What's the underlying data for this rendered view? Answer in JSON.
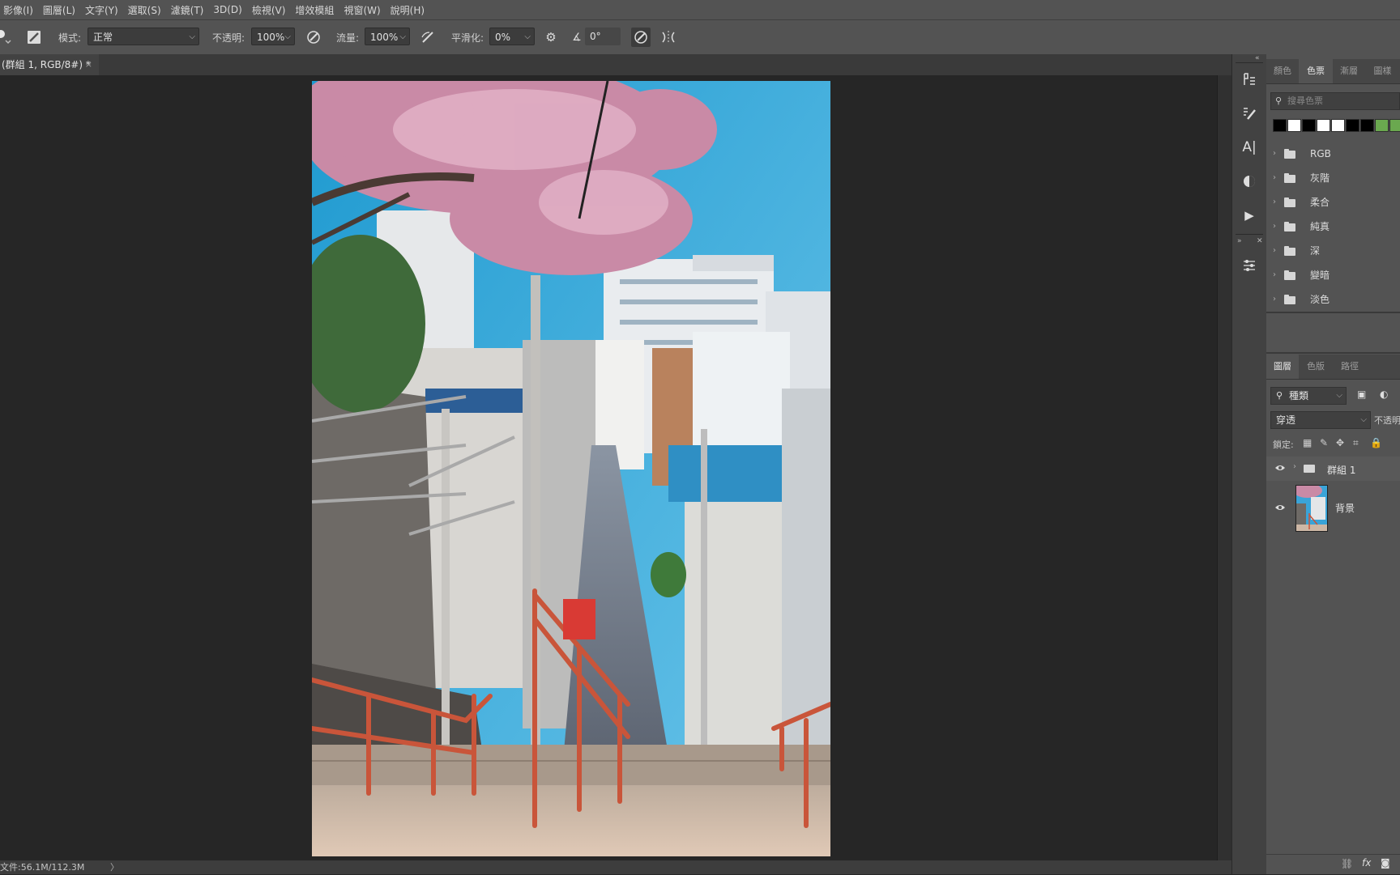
{
  "menubar": {
    "items": [
      "影像(I)",
      "圖層(L)",
      "文字(Y)",
      "選取(S)",
      "濾鏡(T)",
      "3D(D)",
      "檢視(V)",
      "增效模組",
      "視窗(W)",
      "說明(H)"
    ]
  },
  "options": {
    "mode_label": "模式:",
    "mode_value": "正常",
    "opacity_label": "不透明:",
    "opacity_value": "100%",
    "flow_label": "流量:",
    "flow_value": "100%",
    "smoothing_label": "平滑化:",
    "smoothing_value": "0%",
    "angle_value": "0°"
  },
  "document": {
    "tab_title": "(群組 1, RGB/8#) *",
    "close_glyph": "×"
  },
  "statusbar": {
    "doc_info": "文件:56.1M/112.3M",
    "arrow": "〉"
  },
  "swatches_panel": {
    "tabs": [
      "顏色",
      "色票",
      "漸層",
      "圖樣"
    ],
    "active_tab": 1,
    "search_placeholder": "搜尋色票",
    "recent_colors": [
      "#000000",
      "#ffffff",
      "#000000",
      "#ffffff",
      "#ffffff",
      "#000000",
      "#000000",
      "#6aa84f",
      "#6aa84f"
    ],
    "groups": [
      "RGB",
      "灰階",
      "柔合",
      "純真",
      "深",
      "變暗",
      "淡色"
    ]
  },
  "layers_panel": {
    "tabs": [
      "圖層",
      "色版",
      "路徑"
    ],
    "active_tab": 0,
    "filter_value": "種類",
    "blend_value": "穿透",
    "opacity_label": "不透明",
    "lock_label": "鎖定:",
    "layers": [
      {
        "name": "群組 1",
        "type": "group",
        "visible": true
      },
      {
        "name": "背景",
        "type": "image",
        "visible": true
      }
    ]
  }
}
